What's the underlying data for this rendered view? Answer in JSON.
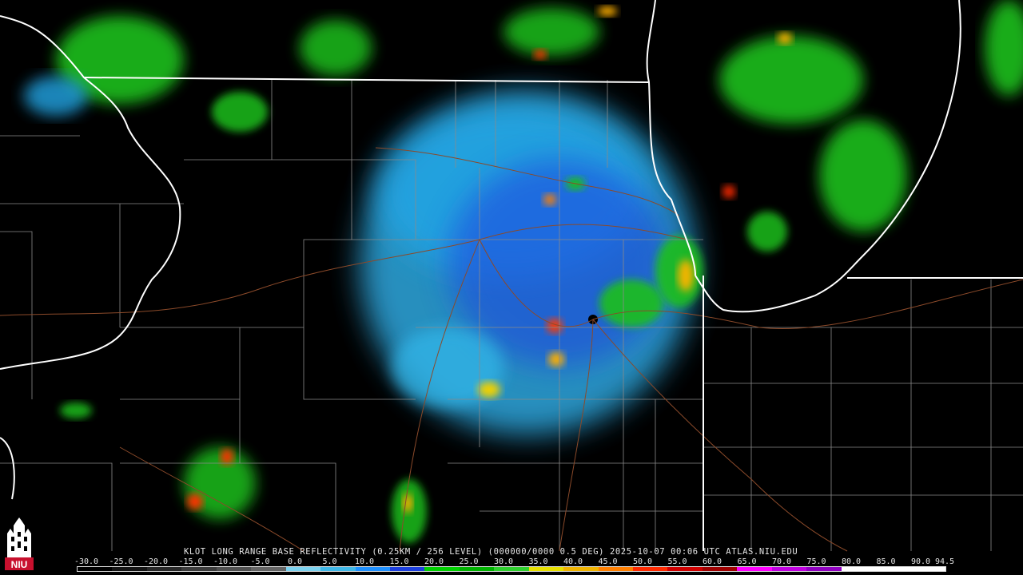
{
  "caption": "KLOT LONG RANGE BASE REFLECTIVITY (0.25KM / 256 LEVEL) (000000/0000 0.5 DEG) 2025-10-07 00:06 UTC  ATLAS.NIU.EDU",
  "scale_labels": [
    "-30.0",
    "-25.0",
    "-20.0",
    "-15.0",
    "-10.0",
    "-5.0",
    "0.0",
    "5.0",
    "10.0",
    "15.0",
    "20.0",
    "25.0",
    "30.0",
    "35.0",
    "40.0",
    "45.0",
    "50.0",
    "55.0",
    "60.0",
    "65.0",
    "70.0",
    "75.0",
    "80.0",
    "85.0",
    "90.0",
    "94.5"
  ],
  "colors": {
    "background": "#000000",
    "state_border": "#ffffff",
    "county_border": "#8a8a8a",
    "highway": "#8b4a2a",
    "scale": [
      "#000000",
      "#141414",
      "#282828",
      "#3c3c3c",
      "#505050",
      "#646464",
      "#7dd3f0",
      "#3fb8e8",
      "#1e90ff",
      "#1c3fe0",
      "#00d100",
      "#00b300",
      "#2ed02e",
      "#e8e000",
      "#f0b400",
      "#ff7f00",
      "#ff2a00",
      "#d00000",
      "#a00000",
      "#ff00ff",
      "#c000e0",
      "#9000c0",
      "#ffffff",
      "#ffffff",
      "#ffffff"
    ]
  },
  "logo": {
    "text": "NIU",
    "icon": "niu-tower-logo-icon"
  }
}
